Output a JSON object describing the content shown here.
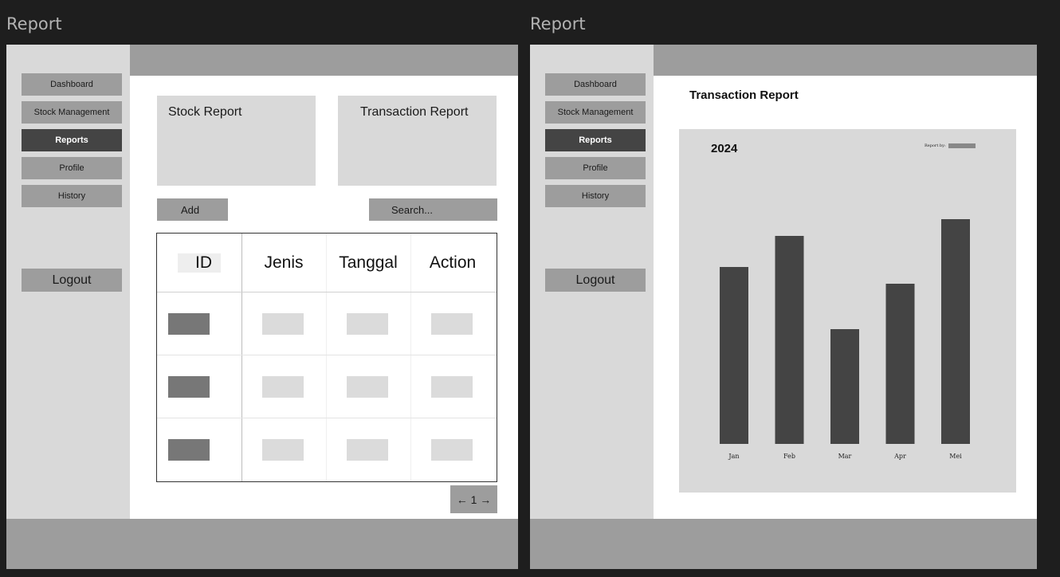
{
  "left": {
    "window_title": "Report",
    "nav": [
      "Dashboard",
      "Stock Management",
      "Reports",
      "Profile",
      "History"
    ],
    "active_nav": "Reports",
    "logout": "Logout",
    "cards": {
      "stock": "Stock Report",
      "transaction": "Transaction Report"
    },
    "add_label": "Add",
    "search_placeholder": "Search...",
    "table": {
      "headers": [
        "ID",
        "Jenis",
        "Tanggal",
        "Action"
      ],
      "row_count": 3
    },
    "pagination": "← 1 →"
  },
  "right": {
    "window_title": "Report",
    "nav": [
      "Dashboard",
      "Stock Management",
      "Reports",
      "Profile",
      "History"
    ],
    "active_nav": "Reports",
    "logout": "Logout",
    "page_title": "Transaction Report",
    "year": "2024",
    "report_by_label": "Report by",
    "report_by_value": "",
    "colors": {
      "bar": "#444444",
      "panel": "#d9d9d9"
    }
  },
  "chart_data": {
    "type": "bar",
    "categories": [
      "Jan",
      "Feb",
      "Mar",
      "Apr",
      "Mei"
    ],
    "values": [
      74,
      87,
      48,
      67,
      94
    ],
    "title": "2024",
    "xlabel": "",
    "ylabel": "",
    "ylim": [
      0,
      100
    ],
    "grid": false
  }
}
